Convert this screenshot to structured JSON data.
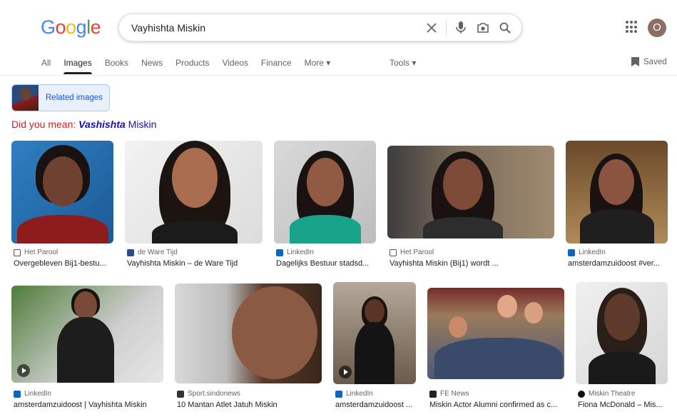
{
  "logo": [
    "G",
    "o",
    "o",
    "g",
    "l",
    "e"
  ],
  "logo_colors": [
    "#4285f4",
    "#ea4335",
    "#fbbc05",
    "#4285f4",
    "#34a853",
    "#ea4335"
  ],
  "search": {
    "query": "Vayhishta Miskin"
  },
  "account": {
    "avatar_letter": "O"
  },
  "nav": {
    "items": [
      "All",
      "Images",
      "Books",
      "News",
      "Products",
      "Videos",
      "Finance",
      "More ▾"
    ],
    "tools": "Tools ▾",
    "saved": "Saved"
  },
  "related": {
    "label": "Related images"
  },
  "did_you_mean": {
    "prefix": "Did you mean: ",
    "emphasis": "Vashishta",
    "rest": " Miskin"
  },
  "results": [
    {
      "source": "Het Parool",
      "caption": "Overgebleven Bij1-bestu...",
      "icon": "parool-icon"
    },
    {
      "source": "de Ware Tijd",
      "caption": "Vayhishta Miskin – de Ware Tijd",
      "icon": "dwt-icon"
    },
    {
      "source": "LinkedIn",
      "caption": "Dagelijks Bestuur stadsd...",
      "icon": "linkedin-icon"
    },
    {
      "source": "Het Parool",
      "caption": "Vayhishta Miskin (Bij1) wordt ...",
      "icon": "parool-icon"
    },
    {
      "source": "LinkedIn",
      "caption": "amsterdamzuidoost #ver...",
      "icon": "linkedin-icon"
    },
    {
      "source": "LinkedIn",
      "caption": "amsterdamzuidoost | Vayhishta Miskin",
      "icon": "linkedin-icon"
    },
    {
      "source": "Sport.sindonews",
      "caption": "10 Mantan Atlet Jatuh Miskin",
      "icon": "sindonews-icon"
    },
    {
      "source": "LinkedIn",
      "caption": "amsterdamzuidoost ...",
      "icon": "linkedin-icon"
    },
    {
      "source": "FE News",
      "caption": "Miskin Actor Alumni confirmed as c...",
      "icon": "fenews-icon"
    },
    {
      "source": "Miskin Theatre",
      "caption": "Fiona McDonald – Mis...",
      "icon": "miskin-theatre-icon"
    }
  ],
  "colors": {
    "link": "#1a0dab",
    "suggest_red": "#c5221f",
    "chip_bg": "#e8f0fe",
    "linkedin": "#0a66c2"
  }
}
